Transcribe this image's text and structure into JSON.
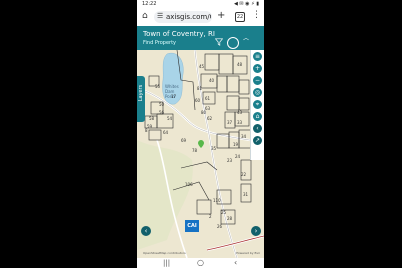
{
  "status": {
    "time": "12:22",
    "indicators": "◀ ✉  ◉ ⚡ ▮"
  },
  "browser": {
    "url": "axisgis.com/Co",
    "tabs_count": "22"
  },
  "app": {
    "title": "Town of Coventry, RI",
    "find_property": "Find Property"
  },
  "map": {
    "pond_label": "Whites Dam Pond",
    "layers_label": "Layers",
    "parcels": [
      {
        "label": "48"
      },
      {
        "label": "45"
      },
      {
        "label": "40"
      },
      {
        "label": "55"
      },
      {
        "label": "81"
      },
      {
        "label": "60"
      },
      {
        "label": "61"
      },
      {
        "label": "63"
      },
      {
        "label": "50"
      },
      {
        "label": "56"
      },
      {
        "label": "58"
      },
      {
        "label": "54"
      },
      {
        "label": "43"
      },
      {
        "label": "33"
      },
      {
        "label": "37"
      },
      {
        "label": "34"
      },
      {
        "label": "19"
      },
      {
        "label": "8"
      },
      {
        "label": "64"
      },
      {
        "label": "78"
      },
      {
        "label": "23"
      },
      {
        "label": "24"
      },
      {
        "label": "35"
      },
      {
        "label": "22"
      },
      {
        "label": "106"
      },
      {
        "label": "110"
      },
      {
        "label": "31"
      },
      {
        "label": "59"
      },
      {
        "label": "17"
      },
      {
        "label": "25"
      },
      {
        "label": "28"
      },
      {
        "label": "69"
      },
      {
        "label": "80"
      },
      {
        "label": "62"
      },
      {
        "label": "26"
      },
      {
        "label": "2"
      }
    ],
    "logo_text": "CAI",
    "attribution": "OpenStreetMap contributors",
    "powered_by": "Powered by Esri"
  },
  "colors": {
    "header": "#1a7f8c",
    "map_bg": "#ede7d1",
    "water": "#a9d4e8",
    "marker": "#58b84a"
  },
  "icons": {
    "home": "home-icon",
    "tune": "tune-icon",
    "plus": "plus-icon",
    "menu": "more-vert-icon",
    "filter": "filter-icon",
    "search": "search-icon",
    "collapse": "chevron-up-icon"
  }
}
